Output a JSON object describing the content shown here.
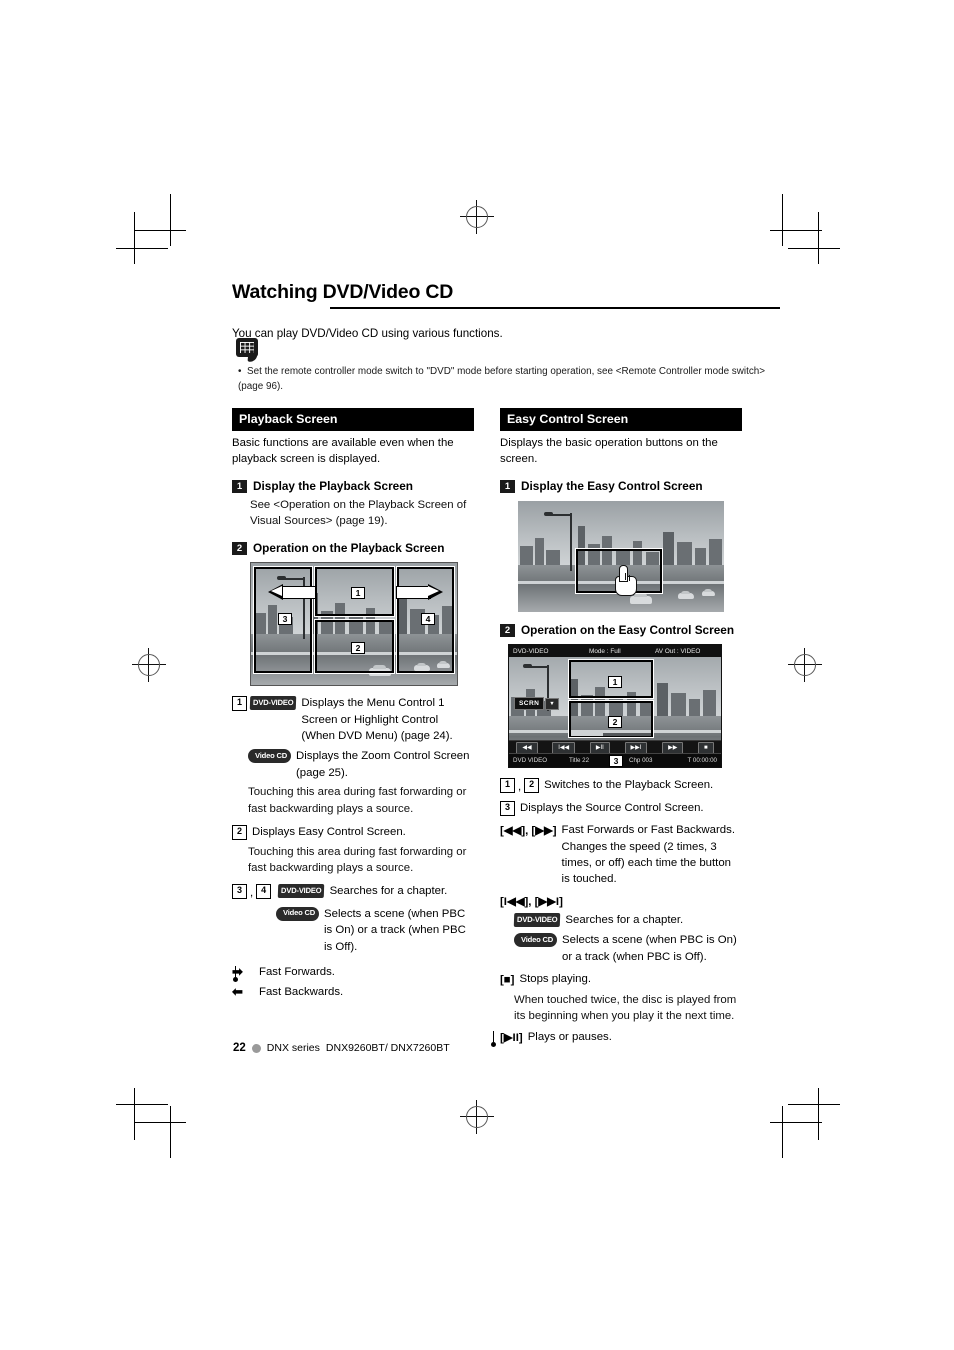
{
  "document": {
    "title": "Watching DVD/Video CD",
    "lede": "You can play DVD/Video CD using various functions.",
    "note": "Set the remote controller mode switch to \"DVD\" mode before starting operation, see <Remote Controller mode switch> (page 96)."
  },
  "footer": {
    "page_number": "22",
    "series": "DNX series",
    "models": "DNX9260BT/ DNX7260BT"
  },
  "left_column": {
    "heading": "Playback Screen",
    "intro": "Basic functions are available even when the playback screen is displayed.",
    "step1": {
      "badge": "1",
      "title": "Display the Playback Screen",
      "body": "See <Operation on the Playback Screen of Visual Sources> (page 19)."
    },
    "step2": {
      "badge": "2",
      "title": "Operation on the Playback Screen"
    },
    "figure": {
      "zone1": "1",
      "zone2": "2",
      "zone3": "3",
      "zone4": "4"
    },
    "items": [
      {
        "key": "1",
        "disc1": "DVD-VIDEO",
        "text1": "Displays the Menu Control 1 Screen or Highlight Control (When DVD Menu) (page 24).",
        "disc2": "Video CD",
        "text2": "Displays the Zoom Control Screen (page 25).",
        "extra": "Touching this area during fast forwarding or fast backwarding plays a source."
      },
      {
        "key": "2",
        "text1": "Displays Easy Control Screen.",
        "extra": "Touching this area during fast forwarding or fast backwarding plays a source."
      },
      {
        "key_a": "3",
        "key_b": "4",
        "disc1": "DVD-VIDEO",
        "text1": "Searches for a chapter.",
        "disc2": "Video CD",
        "text2": "Selects a scene (when PBC is On) or a track (when PBC is Off)."
      }
    ],
    "arrow_items": [
      {
        "glyph": "forward",
        "text": "Fast Forwards."
      },
      {
        "glyph": "backward",
        "text": "Fast Backwards."
      }
    ]
  },
  "right_column": {
    "heading": "Easy Control Screen",
    "intro": "Displays the basic operation buttons on the screen.",
    "step1": {
      "badge": "1",
      "title": "Display the Easy Control Screen"
    },
    "step2": {
      "badge": "2",
      "title": "Operation on the Easy Control Screen"
    },
    "device_screen": {
      "top_left": "DVD-VIDEO",
      "top_center": "Mode : Full",
      "top_right": "AV Out : VIDEO",
      "scrn_button": "SCRN",
      "scrn_arrow": "▼",
      "zone1": "1",
      "zone2": "2",
      "zone3": "3",
      "controls": [
        "◀◀",
        "I◀◀",
        "▶II",
        "▶▶I",
        "▶▶",
        "■"
      ],
      "status_source": "DVD VIDEO",
      "status_title": "Title 22",
      "status_chapter": "Chp 003",
      "status_time": "T 00:00:00"
    },
    "items": [
      {
        "key_a": "1",
        "key_b": "2",
        "text": "Switches to the Playback Screen."
      },
      {
        "key_a": "3",
        "text": "Displays the Source Control Screen."
      },
      {
        "keys": "[◀◀], [▶▶]",
        "text": "Fast Forwards or Fast Backwards. Changes the speed (2 times, 3 times, or off) each time the button is touched."
      },
      {
        "keys": "[I◀◀], [▶▶I]",
        "disc1": "DVD-VIDEO",
        "text1": "Searches for a chapter.",
        "disc2": "Video CD",
        "text2": "Selects a scene (when PBC is On) or a track (when PBC is Off)."
      },
      {
        "keys": "[■]",
        "text": "Stops playing.",
        "extra": "When touched twice, the disc is played from its beginning when you play it the next time."
      },
      {
        "keys": "[▶II]",
        "text": "Plays or pauses."
      }
    ]
  }
}
